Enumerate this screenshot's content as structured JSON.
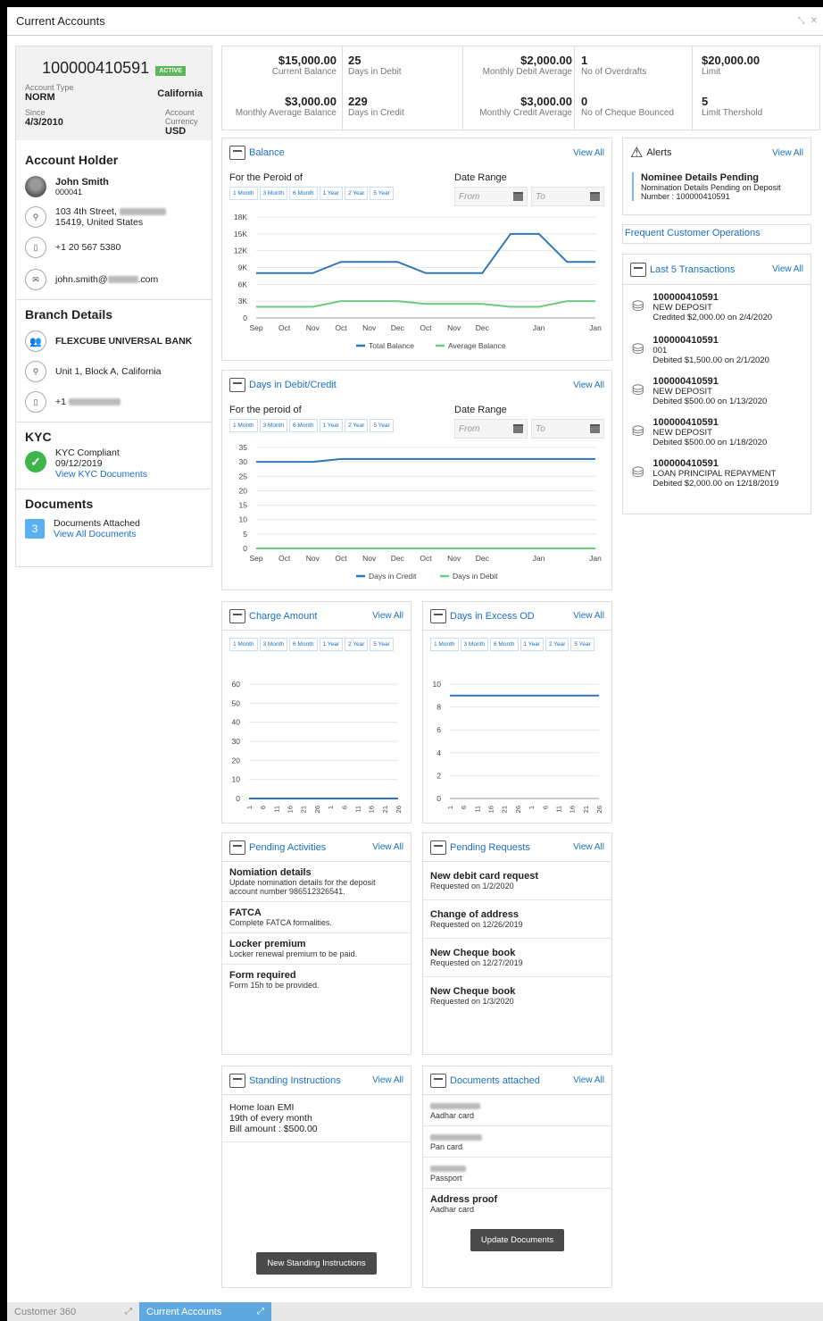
{
  "window": {
    "title": "Current Accounts"
  },
  "taskbar": [
    {
      "label": "Customer 360",
      "active": false
    },
    {
      "label": "Current Accounts",
      "active": true
    }
  ],
  "account": {
    "number": "100000410591",
    "status": "ACTIVE",
    "type_label": "Account Type",
    "type_value": "NORM",
    "branch": "California",
    "since_label": "Since",
    "since_value": "4/3/2010",
    "currency_label_1": "Account",
    "currency_label_2": "Currency",
    "currency_value": "USD"
  },
  "holder": {
    "section_title": "Account Holder",
    "name": "John Smith",
    "id": "000041",
    "address_line1": "103 4th Street,",
    "address_line2": "15419, United States",
    "phone": "+1 20 567 5380",
    "email_prefix": "john.smith@",
    "email_suffix": ".com"
  },
  "branch": {
    "section_title": "Branch Details",
    "bank_name": "FLEXCUBE UNIVERSAL BANK",
    "address": "Unit 1, Block A, California",
    "phone_prefix": "+1"
  },
  "kyc": {
    "section_title": "KYC",
    "status": "KYC Compliant",
    "date": "09/12/2019",
    "link": "View KYC Documents"
  },
  "documents": {
    "section_title": "Documents",
    "count": "3",
    "label": "Documents Attached",
    "link": "View All Documents"
  },
  "summary": [
    {
      "value": "$15,000.00",
      "label": "Current Balance",
      "value2": "25",
      "label2": "Days in Debit"
    },
    {
      "value": "$2,000.00",
      "label": "Monthly Debit Average",
      "value2": "1",
      "label2": "No of Overdrafts"
    },
    {
      "value": "$20,000.00",
      "label": "Limit"
    },
    {
      "value": "$3,000.00",
      "label": "Monthly Average Balance",
      "value2": "229",
      "label2": "Days in Credit"
    },
    {
      "value": "$3,000.00",
      "label": "Monthly Credit Average",
      "value2": "0",
      "label2": "No of Cheque Bounced"
    },
    {
      "value": "5",
      "label": "Limit Thershold"
    }
  ],
  "common": {
    "view_all": "View All",
    "from": "From",
    "to": "To",
    "date_range": "Date Range",
    "periods": [
      "1 Month",
      "3 Month",
      "6 Month",
      "1 Year",
      "2 Year",
      "5 Year"
    ]
  },
  "balance_panel": {
    "title": "Balance",
    "period_label": "For the Peroid of"
  },
  "debit_panel": {
    "title": "Days in Debit/Credit",
    "period_label": "For the peroid of"
  },
  "charge_panel": {
    "title": "Charge Amount"
  },
  "excess_panel": {
    "title": "Days in Excess OD"
  },
  "chart_data": [
    {
      "type": "line",
      "categories": [
        "Sep",
        "Oct",
        "Nov",
        "Oct",
        "Nov",
        "Dec",
        "Oct",
        "Nov",
        "Dec",
        "",
        "Jan",
        "",
        "Jan"
      ],
      "series": [
        {
          "name": "Total Balance",
          "color": "#2f77b5",
          "values": [
            8000,
            8000,
            8000,
            10000,
            10000,
            10000,
            8000,
            8000,
            8000,
            15000,
            15000,
            10000,
            10000
          ]
        },
        {
          "name": "Average Balance",
          "color": "#6ccb82",
          "values": [
            2000,
            2000,
            2000,
            3000,
            3000,
            3000,
            2500,
            2500,
            2500,
            2000,
            2000,
            3000,
            3000
          ]
        }
      ],
      "yticks": [
        "0",
        "3K",
        "6K",
        "9K",
        "12K",
        "15K",
        "18K"
      ],
      "ylim": [
        0,
        18000
      ]
    },
    {
      "type": "line",
      "categories": [
        "Sep",
        "Oct",
        "Nov",
        "Oct",
        "Nov",
        "Dec",
        "Oct",
        "Nov",
        "Dec",
        "",
        "Jan",
        "",
        "Jan"
      ],
      "series": [
        {
          "name": "Days in Credit",
          "color": "#2f77b5",
          "values": [
            30,
            30,
            30,
            31,
            31,
            31,
            31,
            31,
            31,
            31,
            31,
            31,
            31
          ]
        },
        {
          "name": "Days in Debit",
          "color": "#6ccb82",
          "values": [
            0,
            0,
            0,
            0,
            0,
            0,
            0,
            0,
            0,
            0,
            0,
            0,
            0
          ]
        }
      ],
      "yticks": [
        "0",
        "5",
        "10",
        "15",
        "20",
        "25",
        "30",
        "35"
      ],
      "ylim": [
        0,
        35
      ]
    },
    {
      "type": "line",
      "categories": [
        "1",
        "6",
        "11",
        "16",
        "21",
        "26",
        "1",
        "6",
        "11",
        "16",
        "21",
        "26"
      ],
      "series": [
        {
          "color": "#2f77b5",
          "values": [
            0,
            0,
            0,
            0,
            0,
            0,
            0,
            0,
            0,
            0,
            0,
            0
          ]
        }
      ],
      "yticks": [
        "0",
        "10",
        "20",
        "30",
        "40",
        "50",
        "60"
      ],
      "ylim": [
        0,
        60
      ]
    },
    {
      "type": "line",
      "categories": [
        "1",
        "6",
        "11",
        "16",
        "21",
        "26",
        "1",
        "6",
        "11",
        "16",
        "21",
        "26"
      ],
      "series": [
        {
          "color": "#2f77b5",
          "values": [
            9,
            9,
            9,
            9,
            9,
            9,
            9,
            9,
            9,
            9,
            9,
            9
          ]
        }
      ],
      "yticks": [
        "0",
        "2",
        "4",
        "6",
        "8",
        "10"
      ],
      "ylim": [
        0,
        10
      ]
    }
  ],
  "alerts": {
    "title": "Alerts",
    "item_title": "Nominee Details Pending",
    "item_line1": "Nomination Details Pending on Deposit",
    "item_line2": "Number : 100000410591"
  },
  "frequent_ops": {
    "title": "Frequent Customer Operations"
  },
  "transactions": {
    "title": "Last 5 Transactions",
    "items": [
      {
        "account": "100000410591",
        "type": "NEW DEPOSIT",
        "detail": "Credited $2,000.00 on 2/4/2020"
      },
      {
        "account": "100000410591",
        "type": "001",
        "detail": "Debited $1,500.00 on 2/1/2020"
      },
      {
        "account": "100000410591",
        "type": "NEW DEPOSIT",
        "detail": "Debited $500.00 on 1/13/2020"
      },
      {
        "account": "100000410591",
        "type": "NEW DEPOSIT",
        "detail": "Debited $500.00 on 1/18/2020"
      },
      {
        "account": "100000410591",
        "type": "LOAN PRINCIPAL REPAYMENT",
        "detail": "Debited $2,000.00 on 12/18/2019"
      }
    ]
  },
  "pending_activities": {
    "title": "Pending Activities",
    "items": [
      {
        "title": "Nomiation details",
        "desc": "Update nomination details for the deposit account number 986512326541."
      },
      {
        "title": "FATCA",
        "desc": "Complete FATCA formalities."
      },
      {
        "title": "Locker premium",
        "desc": "Locker renewal premium to be paid."
      },
      {
        "title": "Form required",
        "desc": "Form 15h to be provided."
      }
    ]
  },
  "pending_requests": {
    "title": "Pending Requests",
    "items": [
      {
        "title": "New debit card request",
        "desc": "Requested on 1/2/2020"
      },
      {
        "title": "Change of address",
        "desc": "Requested on 12/26/2019"
      },
      {
        "title": "New Cheque book",
        "desc": "Requested on 12/27/2019"
      },
      {
        "title": "New Cheque book",
        "desc": "Requested on 1/3/2020"
      }
    ]
  },
  "standing_instructions": {
    "title": "Standing Instructions",
    "line1": "Home loan EMI",
    "line2": "19th of every month",
    "line3": "Bill amount : $500.00",
    "button": "New Standing Instructions"
  },
  "documents_attached": {
    "title": "Documents attached",
    "items": [
      {
        "label": "Aadhar card"
      },
      {
        "label": "Pan card"
      },
      {
        "label": "Passport"
      },
      {
        "title": "Address proof",
        "label": "Aadhar card"
      }
    ],
    "button": "Update Documents"
  }
}
